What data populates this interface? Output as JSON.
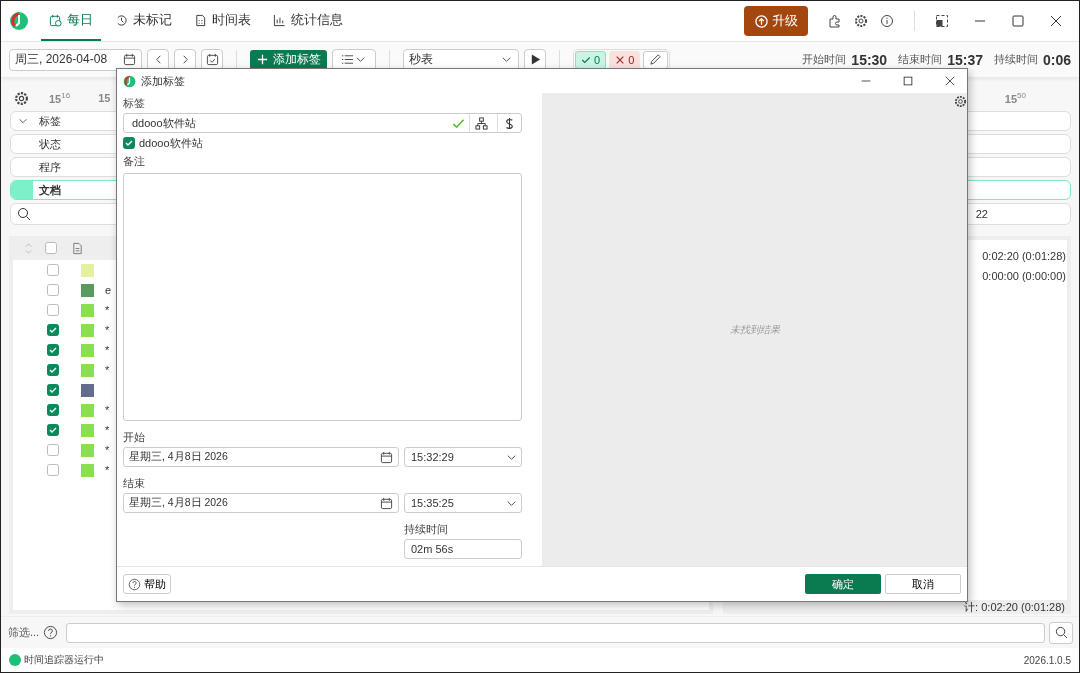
{
  "app": {
    "tabs": [
      {
        "label": "每日",
        "selected": true,
        "kind": "daily"
      },
      {
        "label": "未标记",
        "selected": false,
        "kind": "untagged"
      },
      {
        "label": "时间表",
        "selected": false,
        "kind": "timesheet"
      },
      {
        "label": "统计信息",
        "selected": false,
        "kind": "stats"
      }
    ],
    "upgrade_button": "升级"
  },
  "toolbar": {
    "date": "周三, 2026-04-08",
    "add_tag_button": "添加标签",
    "view_select": "秒表",
    "confirmed_count": "0",
    "rejected_count": "0",
    "start_label": "开始时间",
    "start_time": "15:30",
    "end_label": "结束时间",
    "end_time": "15:37",
    "duration_label": "持续时间",
    "duration": "0:06"
  },
  "timeline": {
    "ticks_left": [
      {
        "text": "15",
        "sup": "16"
      },
      {
        "text": "15"
      }
    ],
    "ticks_right": [
      {
        "text": "15",
        "sup": "50"
      }
    ],
    "rows": [
      {
        "label": "标签",
        "kind": "group",
        "selected": false
      },
      {
        "label": "状态",
        "kind": "item",
        "selected": false
      },
      {
        "label": "程序",
        "kind": "item",
        "selected": false
      },
      {
        "label": "文档",
        "kind": "item",
        "selected": true
      }
    ],
    "search_row_text": "22"
  },
  "table": {
    "all_checked": false,
    "rows": [
      {
        "checked": false,
        "color": "#e2f0a0"
      },
      {
        "checked": false,
        "color": "#5a9a5e",
        "text": "e"
      },
      {
        "checked": false,
        "color": "#88e050",
        "text": "*"
      },
      {
        "checked": true,
        "color": "#88e050",
        "text": "*"
      },
      {
        "checked": true,
        "color": "#88e050",
        "text": "*"
      },
      {
        "checked": true,
        "color": "#88e050",
        "text": "*"
      },
      {
        "checked": true,
        "color": "#646c8c"
      },
      {
        "checked": true,
        "color": "#88e050",
        "text": "*"
      },
      {
        "checked": true,
        "color": "#88e050",
        "text": "*"
      },
      {
        "checked": false,
        "color": "#88e050",
        "text": "*"
      },
      {
        "checked": false,
        "color": "#88e050",
        "text": "*"
      }
    ]
  },
  "summary": {
    "rows": [
      "0:02:20 (0:01:28)",
      "0:00:00 (0:00:00)"
    ],
    "total": "计: 0:02:20 (0:01:28)"
  },
  "filter": {
    "label": "筛选..."
  },
  "status_bar": {
    "status": "时间追踪器运行中",
    "version": "2026.1.0.5"
  },
  "dialog": {
    "title": "添加标签",
    "tag_label": "标签",
    "tag_value": "ddooo软件站",
    "tag_checkbox": {
      "label": "ddooo软件站",
      "checked": true
    },
    "note_label": "备注",
    "start_label": "开始",
    "start_date": "星期三, 4月8日 2026",
    "start_time": "15:32:29",
    "end_label": "结束",
    "end_date": "星期三, 4月8日 2026",
    "end_time": "15:35:25",
    "duration_label": "持续时间",
    "duration": "02m 56s",
    "results_empty": "未找到结果",
    "help_button": "帮助",
    "ok_button": "确定",
    "cancel_button": "取消"
  }
}
